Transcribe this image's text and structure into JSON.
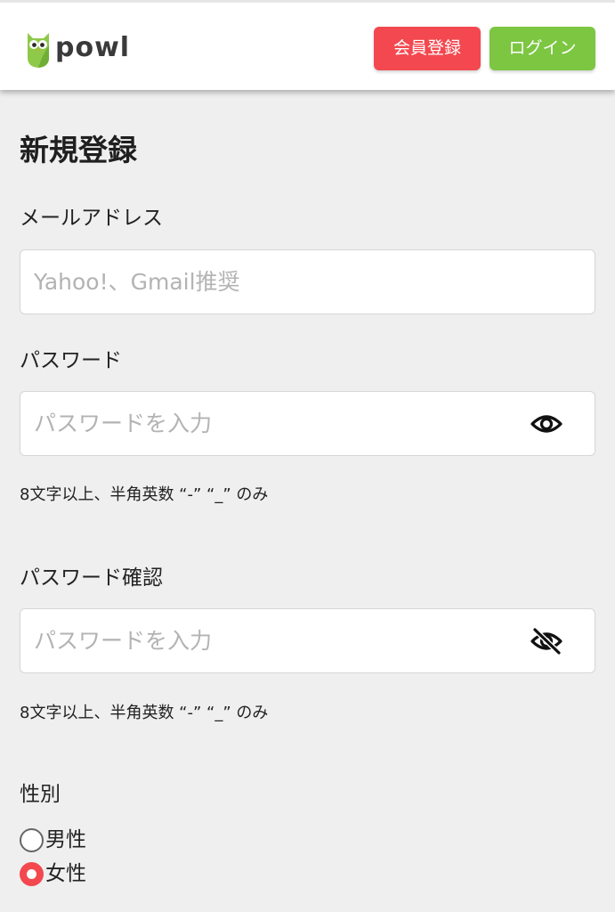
{
  "header": {
    "logo_text": "powl",
    "register_button": "会員登録",
    "login_button": "ログイン",
    "register_color": "#f3484f",
    "login_color": "#7cc642"
  },
  "form": {
    "title": "新規登録",
    "email": {
      "label": "メールアドレス",
      "placeholder": "Yahoo!、Gmail推奨",
      "value": ""
    },
    "password": {
      "label": "パスワード",
      "placeholder": "パスワードを入力",
      "value": "",
      "hint": "8文字以上、半角英数 “-” “_” のみ",
      "visibility_icon": "eye-icon"
    },
    "password_confirm": {
      "label": "パスワード確認",
      "placeholder": "パスワードを入力",
      "value": "",
      "hint": "8文字以上、半角英数 “-” “_” のみ",
      "visibility_icon": "eye-off-icon"
    },
    "gender": {
      "label": "性別",
      "options": [
        {
          "label": "男性",
          "checked": false
        },
        {
          "label": "女性",
          "checked": true
        }
      ]
    }
  }
}
